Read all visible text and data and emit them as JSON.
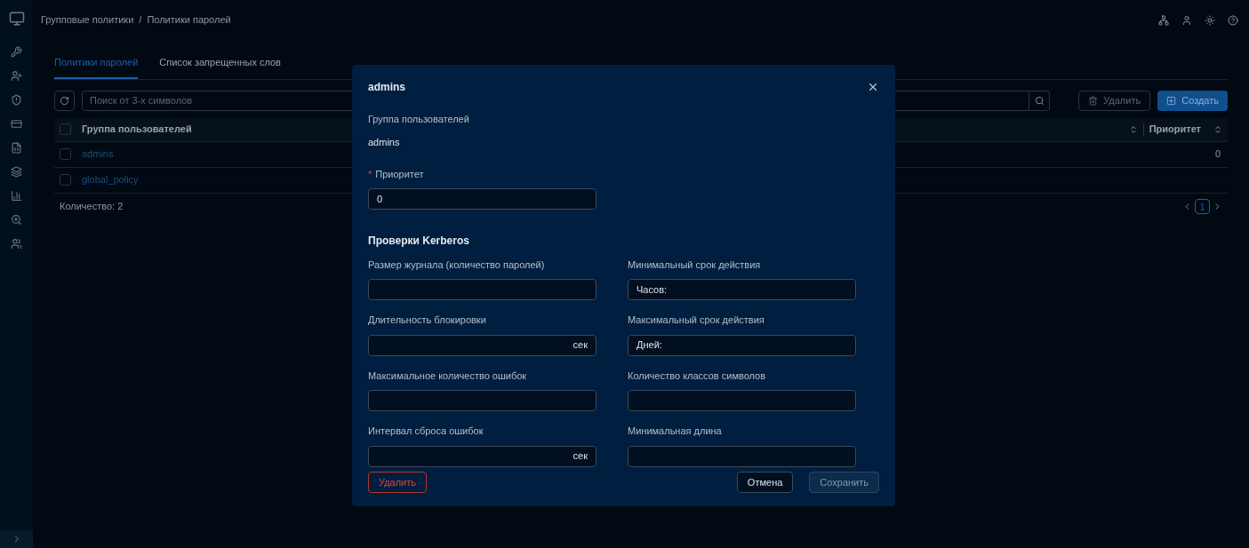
{
  "breadcrumbs": [
    "Групповые политики",
    "Политики паролей"
  ],
  "breadcrumb_separator": "/",
  "tabs": [
    {
      "label": "Политики паролей",
      "selected": true
    },
    {
      "label": "Список запрещенных слов",
      "selected": false
    }
  ],
  "search": {
    "placeholder": "Поиск от 3-х символов"
  },
  "toolbar": {
    "delete": "Удалить",
    "create": "Создать"
  },
  "table": {
    "header_checked": false,
    "columns": [
      "Группа пользователей",
      "Приоритет"
    ],
    "rows": [
      {
        "group": "admins",
        "priority": "0",
        "checked": false
      },
      {
        "group": "global_policy",
        "checked": false
      }
    ]
  },
  "count": "Количество: 2",
  "pagination": [
    {
      "label": "1",
      "selected": true
    }
  ],
  "dialog": {
    "title": "admins",
    "group_label": "Группа пользователей",
    "group_value": "admins",
    "priority": {
      "label": "Приоритет",
      "required_mark": "*",
      "value": "0"
    },
    "section": "Проверки Kerberos",
    "fields": [
      {
        "label": "Размер журнала (количество паролей)"
      },
      {
        "label": "Минимальный срок действия",
        "prefix": "Часов:"
      },
      {
        "label": "Длительность блокировки",
        "suffix": "сек"
      },
      {
        "label": "Максимальный срок действия",
        "prefix": "Дней:"
      },
      {
        "label": "Максимальное количество ошибок"
      },
      {
        "label": "Количество классов символов"
      },
      {
        "label": "Интервал сброса ошибок",
        "suffix": "сек"
      },
      {
        "label": "Минимальная длина"
      }
    ],
    "delete": "Удалить",
    "cancel": "Отмена",
    "save": "Сохранить"
  }
}
